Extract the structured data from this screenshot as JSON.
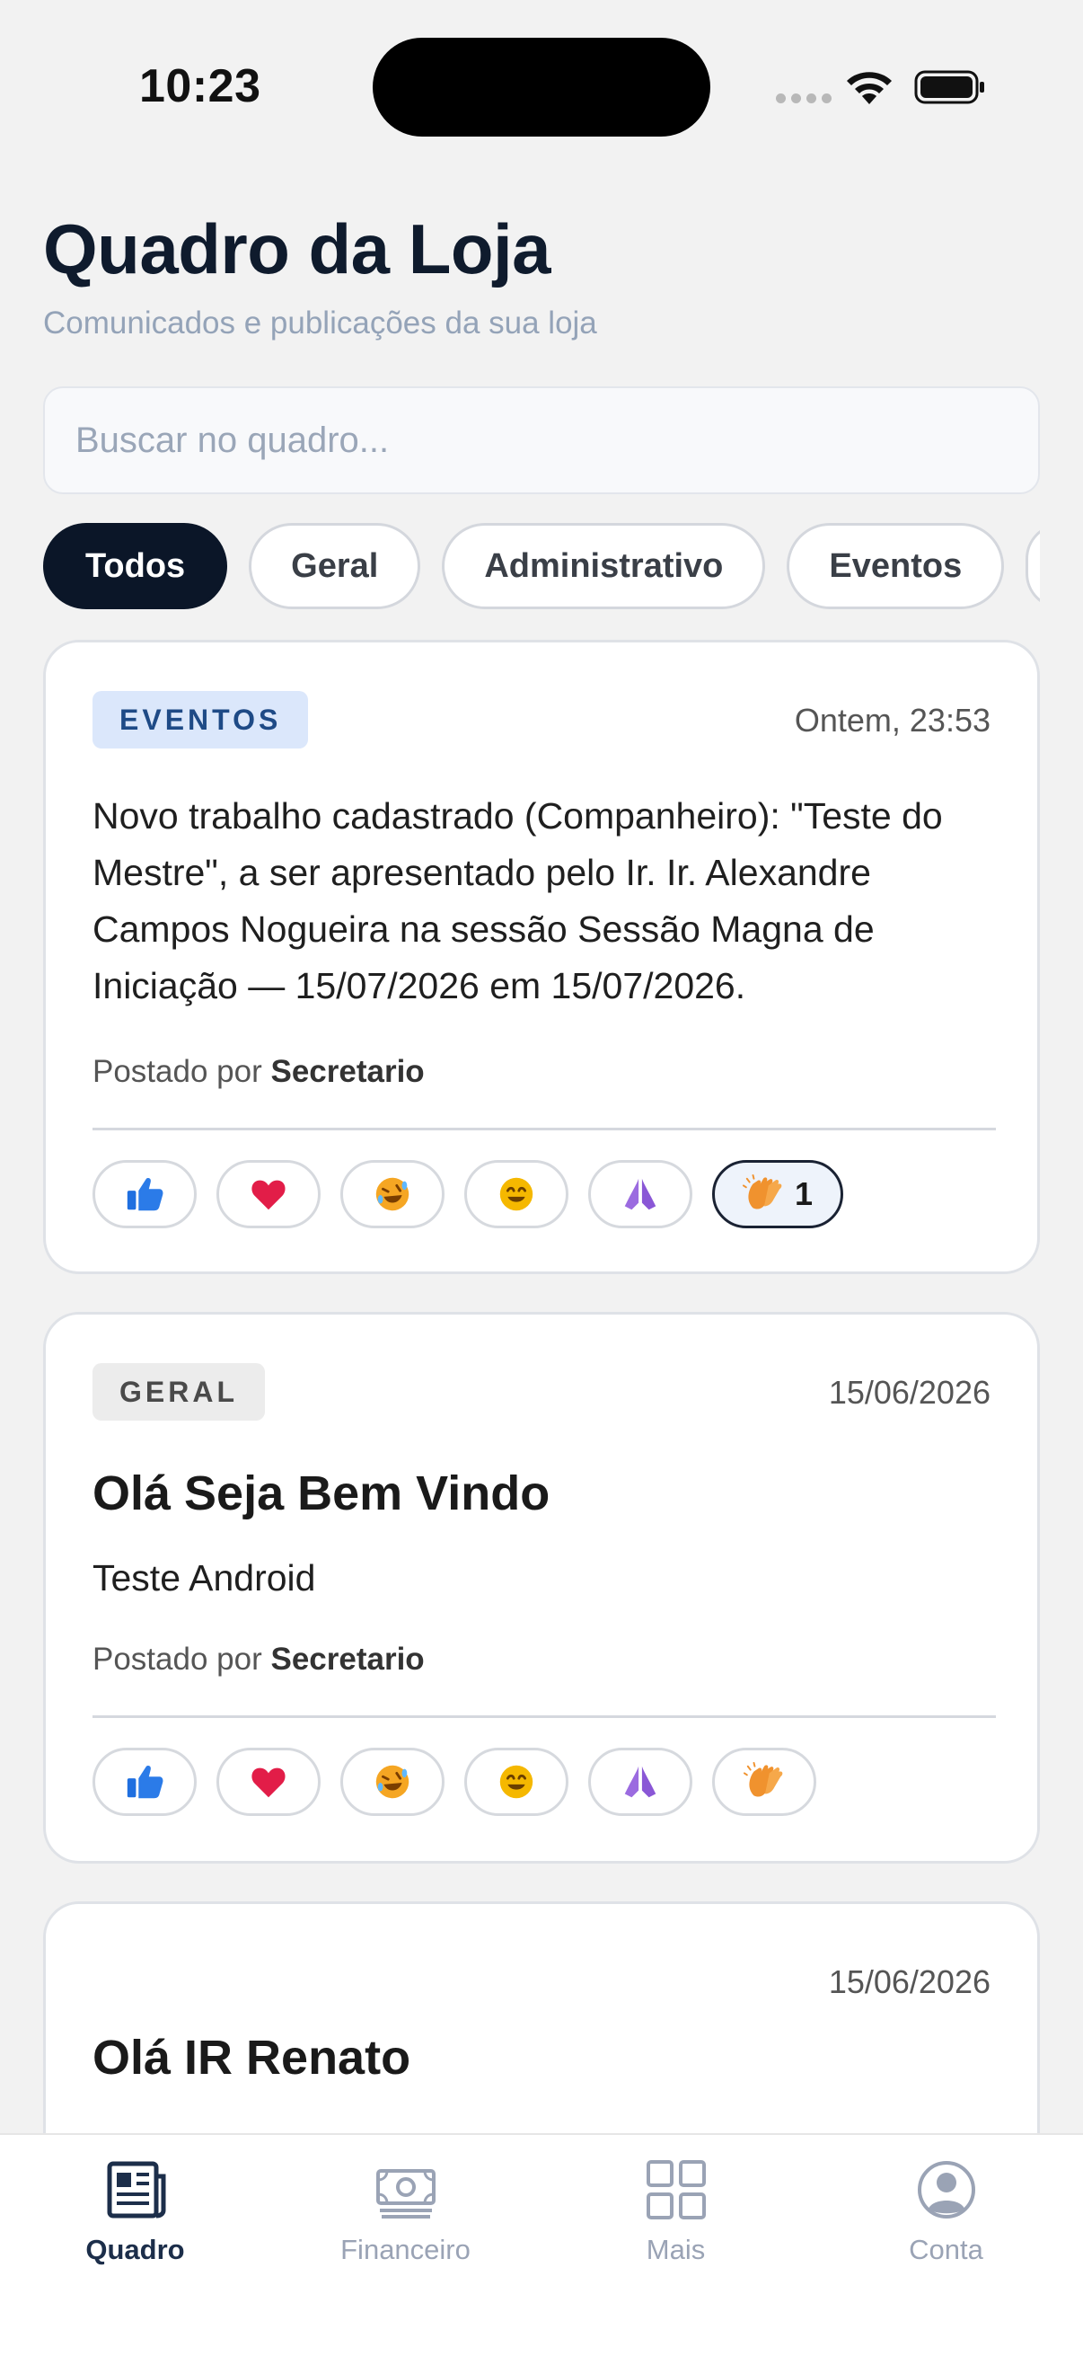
{
  "status_bar": {
    "time": "10:23"
  },
  "header": {
    "title": "Quadro da Loja",
    "subtitle": "Comunicados e publicações da sua loja"
  },
  "search": {
    "placeholder": "Buscar no quadro..."
  },
  "filters": {
    "active": "Todos",
    "items": [
      "Todos",
      "Geral",
      "Administrativo",
      "Eventos"
    ]
  },
  "posts": [
    {
      "category": "EVENTOS",
      "date": "Ontem, 23:53",
      "text": "Novo trabalho cadastrado (Companheiro): \"Teste do Mestre\", a ser apresentado pelo Ir. Ir. Alexandre Campos Nogueira na sessão Sessão Magna de Iniciação — 15/07/2026 em 15/07/2026.",
      "posted_prefix": "Postado por ",
      "author": "Secretario",
      "reactions": [
        {
          "icon": "thumbs-up-icon",
          "count": ""
        },
        {
          "icon": "heart-icon",
          "count": ""
        },
        {
          "icon": "laugh-icon",
          "count": ""
        },
        {
          "icon": "smile-icon",
          "count": ""
        },
        {
          "icon": "praying-hands-icon",
          "count": ""
        },
        {
          "icon": "clapping-hands-icon",
          "count": "1",
          "selected": true
        }
      ]
    },
    {
      "category": "GERAL",
      "date": "15/06/2026",
      "title": "Olá Seja Bem Vindo",
      "text": "Teste Android",
      "posted_prefix": "Postado por ",
      "author": "Secretario",
      "reactions": [
        {
          "icon": "thumbs-up-icon",
          "count": ""
        },
        {
          "icon": "heart-icon",
          "count": ""
        },
        {
          "icon": "laugh-icon",
          "count": ""
        },
        {
          "icon": "smile-icon",
          "count": ""
        },
        {
          "icon": "praying-hands-icon",
          "count": ""
        },
        {
          "icon": "clapping-hands-icon",
          "count": ""
        }
      ]
    },
    {
      "date": "15/06/2026",
      "title": "Olá IR Renato"
    }
  ],
  "tab_bar": {
    "active": "Quadro",
    "tabs": [
      {
        "label": "Quadro",
        "icon": "newspaper-icon"
      },
      {
        "label": "Financeiro",
        "icon": "money-icon"
      },
      {
        "label": "Mais",
        "icon": "grid-icon"
      },
      {
        "label": "Conta",
        "icon": "user-circle-icon"
      }
    ]
  },
  "colors": {
    "background": "#f2f2f2",
    "primary_dark": "#0b1628",
    "tag_eventos_bg": "#dbe7fb",
    "tag_eventos_text": "#1e4a86",
    "tag_geral_bg": "#ececec",
    "active_tab": "#1c2e4a",
    "inactive_tab": "#9aa3b5"
  }
}
